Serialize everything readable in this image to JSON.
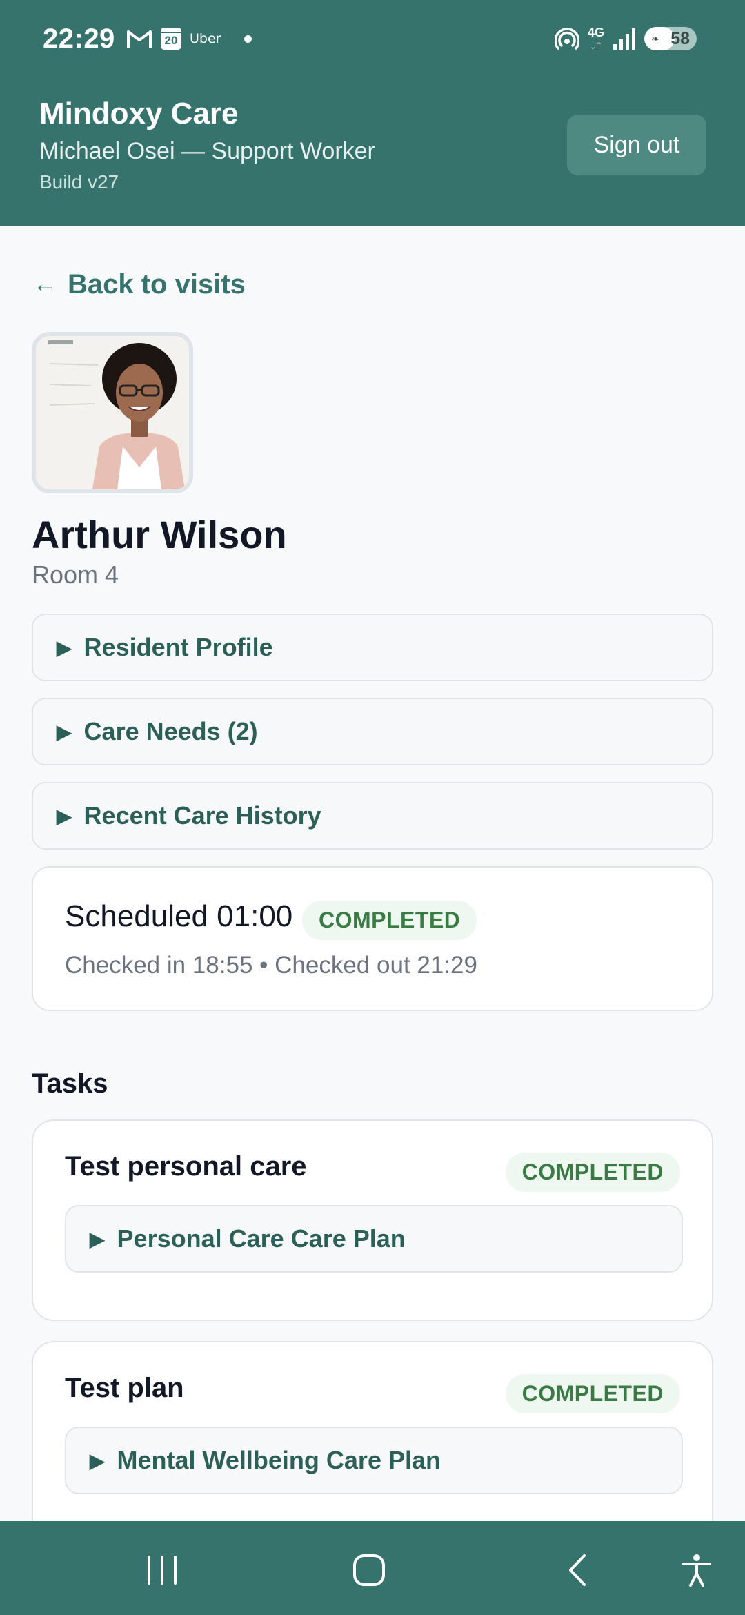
{
  "status_bar": {
    "time": "22:29",
    "calendar_day": "20",
    "uber_label": "Uber",
    "network": "4G",
    "battery": "58",
    "battery_level": 0.58
  },
  "header": {
    "app_title": "Mindoxy Care",
    "user_line": "Michael Osei — Support Worker",
    "build": "Build v27",
    "signout_label": "Sign out"
  },
  "back_link": {
    "arrow": "←",
    "label": "Back to visits"
  },
  "resident": {
    "name": "Arthur Wilson",
    "room": "Room 4",
    "avatar_icon": "resident-photo"
  },
  "sections": [
    {
      "label": "Resident Profile"
    },
    {
      "label": "Care Needs (2)"
    },
    {
      "label": "Recent Care History"
    }
  ],
  "visit": {
    "scheduled": "Scheduled 01:00",
    "status": "COMPLETED",
    "times": "Checked in 18:55 • Checked out 21:29"
  },
  "tasks": {
    "heading": "Tasks",
    "items": [
      {
        "title": "Test personal care",
        "status": "COMPLETED",
        "plan": "Personal Care Care Plan"
      },
      {
        "title": "Test plan",
        "status": "COMPLETED",
        "plan": "Mental Wellbeing Care Plan"
      }
    ]
  },
  "colors": {
    "brand": "#36736c",
    "success_text": "#3a7a45",
    "success_bg": "#eef7f0"
  },
  "nav_icons": [
    "recent-apps-icon",
    "home-icon",
    "back-icon",
    "accessibility-icon"
  ]
}
